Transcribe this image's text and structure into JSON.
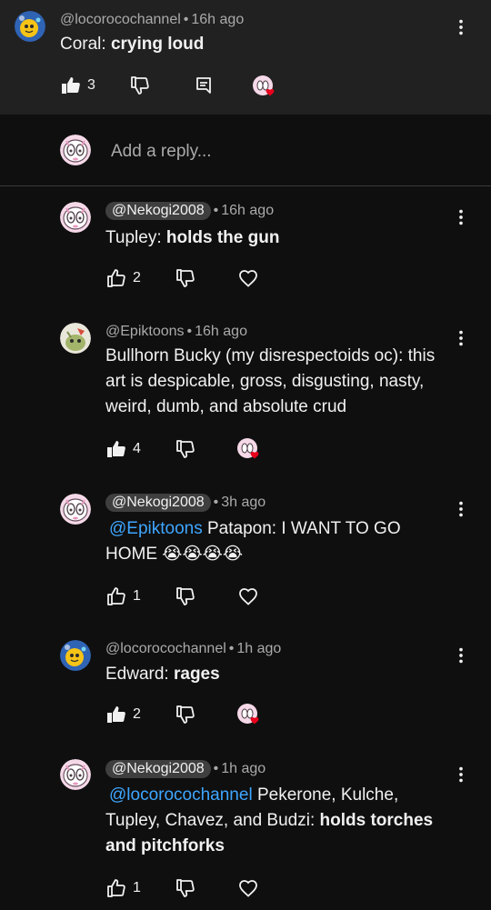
{
  "parent_comment": {
    "author": "@locorocochannel",
    "time": "16h ago",
    "prefix": "Coral: ",
    "bold": "crying loud",
    "likes": "3"
  },
  "reply_box": {
    "placeholder": "Add a reply..."
  },
  "replies": [
    {
      "author": "@Nekogi2008",
      "time": "16h ago",
      "lines": [
        {
          "prefix": "Tupley: ",
          "bold": "holds the gun"
        }
      ],
      "likes": "2"
    },
    {
      "author": "@Epiktoons",
      "time": "16h ago",
      "lines": [
        "Bullhorn Bucky (my disrespectoids oc): this",
        "art is despicable, gross, disgusting, nasty,",
        "weird, dumb, and absolute crud"
      ],
      "likes": "4"
    },
    {
      "author": "@Nekogi2008",
      "time": "3h ago",
      "mention": "@Epiktoons",
      "line1_text": " Patapon: I WANT TO GO",
      "line2_text": "HOME ",
      "emoji": "😭😭😭😭",
      "likes": "1"
    },
    {
      "author": "@locorocochannel",
      "time": "1h ago",
      "prefix": "Edward: ",
      "bold": "rages",
      "likes": "2"
    },
    {
      "author": "@Nekogi2008",
      "time": "1h ago",
      "mention": "@locorocochannel",
      "line1_text": " Pekerone, Kulche,",
      "line2_prefix": "Tupley, Chavez, and Budzi: ",
      "line2_bold": "holds torches",
      "line3_bold": "and pitchforks",
      "likes": "1"
    }
  ],
  "separator": "•",
  "icons": [
    "thumbs-up-icon",
    "thumbs-down-icon",
    "comment-icon",
    "heart-icon",
    "more-vert-icon"
  ],
  "colors": {
    "background": "#0f0f0f",
    "parent_bg": "#212121",
    "mention": "#3ea6ff",
    "heart": "#e8001c",
    "muted": "#aaaaaa"
  }
}
